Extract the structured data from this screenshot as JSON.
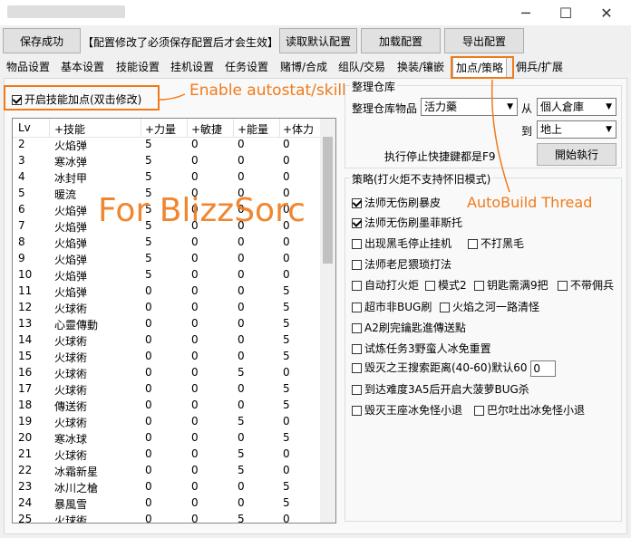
{
  "window": {
    "min": "─",
    "max": "☐",
    "close": "✕"
  },
  "toolbar": {
    "save_label": "保存成功",
    "notice": "【配置修改了必须保存配置后才会生效】",
    "read_default": "读取默认配置",
    "load": "加载配置",
    "export": "导出配置"
  },
  "tabs": [
    "物品设置",
    "基本设置",
    "技能设置",
    "挂机设置",
    "任务设置",
    "赌博/合成",
    "组队/交易",
    "换装/镶嵌",
    "加点/策略",
    "佣兵/扩展"
  ],
  "left": {
    "enable_label": "开启技能加点(双击修改)",
    "annotation": "Enable autostat/skill",
    "watermark": "For BlizzSorc",
    "headers": [
      "Lv",
      "+技能",
      "+力量",
      "+敏捷",
      "+能量",
      "+体力"
    ],
    "rows": [
      [
        "2",
        "火焰弹",
        "5",
        "0",
        "0",
        "0"
      ],
      [
        "3",
        "寒冰弹",
        "5",
        "0",
        "0",
        "0"
      ],
      [
        "4",
        "冰封甲",
        "5",
        "0",
        "0",
        "0"
      ],
      [
        "5",
        "暖流",
        "5",
        "0",
        "0",
        "0"
      ],
      [
        "6",
        "火焰弹",
        "5",
        "0",
        "0",
        "0"
      ],
      [
        "7",
        "火焰弹",
        "5",
        "0",
        "0",
        "0"
      ],
      [
        "8",
        "火焰弹",
        "5",
        "0",
        "0",
        "0"
      ],
      [
        "9",
        "火焰弹",
        "5",
        "0",
        "0",
        "0"
      ],
      [
        "10",
        "火焰弹",
        "5",
        "0",
        "0",
        "0"
      ],
      [
        "11",
        "火焰弹",
        "0",
        "0",
        "0",
        "5"
      ],
      [
        "12",
        "火球術",
        "0",
        "0",
        "0",
        "5"
      ],
      [
        "13",
        "心靈傳動",
        "0",
        "0",
        "0",
        "5"
      ],
      [
        "14",
        "火球術",
        "0",
        "0",
        "0",
        "5"
      ],
      [
        "15",
        "火球術",
        "0",
        "0",
        "0",
        "5"
      ],
      [
        "16",
        "火球術",
        "0",
        "0",
        "5",
        "0"
      ],
      [
        "17",
        "火球術",
        "0",
        "0",
        "0",
        "5"
      ],
      [
        "18",
        "傳送術",
        "0",
        "0",
        "0",
        "5"
      ],
      [
        "19",
        "火球術",
        "0",
        "0",
        "5",
        "0"
      ],
      [
        "20",
        "寒冰球",
        "0",
        "0",
        "0",
        "5"
      ],
      [
        "21",
        "火球術",
        "0",
        "0",
        "5",
        "0"
      ],
      [
        "22",
        "冰霜新星",
        "0",
        "0",
        "5",
        "0"
      ],
      [
        "23",
        "冰川之槍",
        "0",
        "0",
        "0",
        "5"
      ],
      [
        "24",
        "暴風雪",
        "0",
        "0",
        "0",
        "5"
      ],
      [
        "25",
        "火球術",
        "0",
        "0",
        "5",
        "0"
      ]
    ]
  },
  "storage": {
    "title": "整理仓库",
    "items_label": "整理仓库物品",
    "item_value": "活力藥",
    "from_label": "从",
    "from_value": "個人倉庫",
    "to_label": "到",
    "to_value": "地上",
    "hotkey_text": "执行停止快捷鍵都是F9",
    "start_button": "開始執行"
  },
  "strategy": {
    "title": "策略(打火炬不支持怀旧模式)",
    "annotation": "AutoBuild Thread",
    "opt1": "法师无伤刷暴皮",
    "opt2": "法师无伤刷墨菲斯托",
    "opt3": "出现黑毛停止挂机",
    "opt4": "不打黑毛",
    "opt5": "法师老尼猥琐打法",
    "opt6": "自动打火炬",
    "opt7": "模式2",
    "opt8": "钥匙需满9把",
    "opt9": "不带佣兵",
    "opt10": "超市非BUG刷",
    "opt11": "火焰之河一路清怪",
    "opt12": "A2刷完鑰匙進傳送點",
    "opt13": "试炼任务3野蛮人冰免重置",
    "opt14": "毁灭之王搜索距离(40-60)默认60",
    "opt14_value": "0",
    "opt15": "到达难度3A5后开启大菠萝BUG杀",
    "opt16": "毁灭王座冰免怪小退",
    "opt17": "巴尔吐出冰免怪小退"
  }
}
